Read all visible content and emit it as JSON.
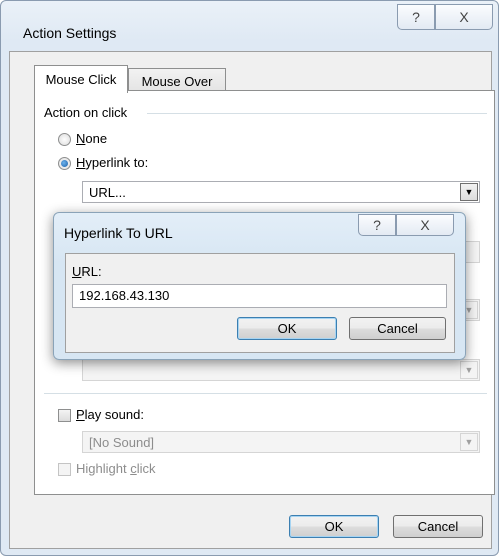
{
  "window": {
    "title": "Action Settings",
    "help_glyph": "?",
    "close_glyph": "X"
  },
  "tabs": [
    "Mouse Click",
    "Mouse Over"
  ],
  "action_group": {
    "title": "Action on click",
    "none_pre": "",
    "none_key": "N",
    "none_post": "one",
    "hyperlink_pre": "",
    "hyperlink_key": "H",
    "hyperlink_post": "yperlink to:",
    "hyperlink_value": "URL...",
    "selected": "hyperlink"
  },
  "sound": {
    "label_pre": "",
    "label_key": "P",
    "label_post": "lay sound:",
    "value": "[No Sound]",
    "checked": false
  },
  "highlight": {
    "label_pre": "Highlight ",
    "label_key": "c",
    "label_post": "lick",
    "enabled": false
  },
  "footer": {
    "ok": "OK",
    "cancel": "Cancel"
  },
  "popup": {
    "title": "Hyperlink To URL",
    "help_glyph": "?",
    "close_glyph": "X",
    "url_label_key": "U",
    "url_label_post": "RL:",
    "url_value": "192.168.43.130",
    "ok": "OK",
    "cancel": "Cancel"
  }
}
